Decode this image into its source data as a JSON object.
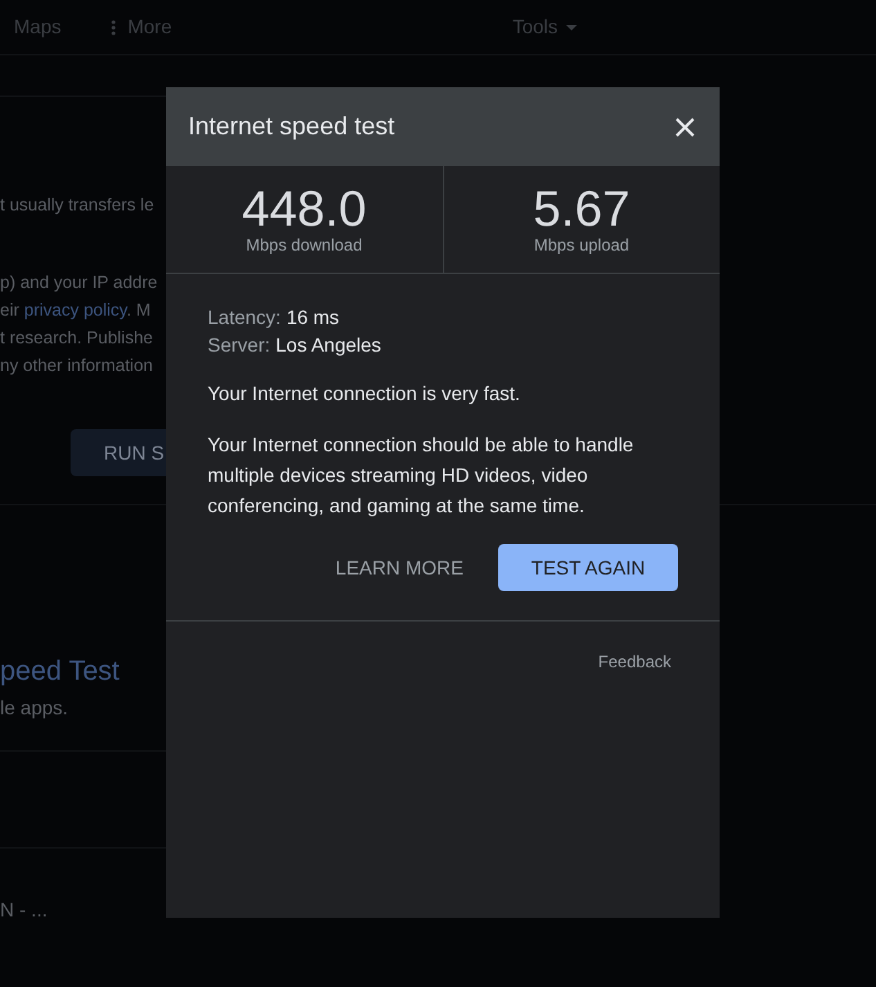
{
  "nav": [
    {
      "label": "Maps",
      "kind": "plain"
    },
    {
      "label": "More",
      "kind": "menu"
    }
  ],
  "tools": {
    "label": "Tools"
  },
  "background": {
    "lines": [
      {
        "text": "t usually transfers le"
      },
      {
        "text": "p) and your IP addre"
      },
      {
        "text": "eir ",
        "link": "privacy policy",
        "after": ". M"
      },
      {
        "text": "t research. Publishe"
      },
      {
        "text": "ny other information"
      }
    ],
    "button": "RUN S",
    "result_title": "peed Test",
    "result_subtitle": "le apps.",
    "list_item": "N - ..."
  },
  "dialog": {
    "title": "Internet speed test",
    "stats": [
      {
        "value": "448.0",
        "unit": "Mbps download"
      },
      {
        "value": "5.67",
        "unit": "Mbps upload"
      }
    ],
    "details": [
      {
        "label": "Latency:",
        "value": "16 ms"
      },
      {
        "label": "Server:",
        "value": "Los Angeles"
      }
    ],
    "summary": "Your Internet connection is very fast.",
    "description": "Your Internet connection should be able to handle multiple devices streaming HD videos, video conferencing, and gaming at the same time.",
    "actions": [
      {
        "label": "LEARN MORE",
        "kind": "text"
      },
      {
        "label": "TEST AGAIN",
        "kind": "filled"
      }
    ],
    "feedback": "Feedback"
  }
}
